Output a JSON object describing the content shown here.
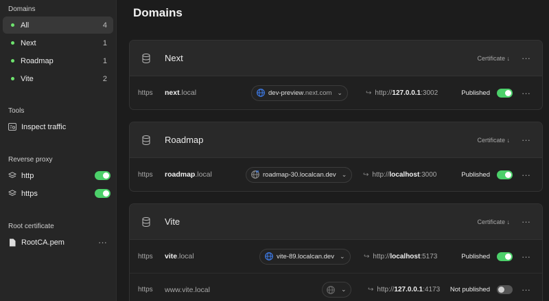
{
  "sidebar": {
    "domains_title": "Domains",
    "domains": [
      {
        "label": "All",
        "count": "4",
        "active": true
      },
      {
        "label": "Next",
        "count": "1"
      },
      {
        "label": "Roadmap",
        "count": "1"
      },
      {
        "label": "Vite",
        "count": "2"
      }
    ],
    "tools_title": "Tools",
    "tools": [
      {
        "label": "Inspect traffic",
        "icon": "inspect-traffic-icon"
      }
    ],
    "proxy_title": "Reverse proxy",
    "proxy": [
      {
        "label": "http",
        "icon": "layers-icon",
        "enabled": true
      },
      {
        "label": "https",
        "icon": "layers-icon",
        "enabled": true
      }
    ],
    "root_title": "Root certificate",
    "root": {
      "label": "RootCA.pem",
      "icon": "file-icon",
      "more": "···"
    }
  },
  "main": {
    "title": "Domains",
    "cards": [
      {
        "name": "Next",
        "cert_label": "Certificate ↓",
        "more": "···",
        "rows": [
          {
            "scheme": "https",
            "host_bold": "next",
            "host_rest": ".local",
            "tunnel_main": "dev-preview",
            "tunnel_rest": ".next.com",
            "target_prefix": "http://",
            "target_bold": "127.0.0.1",
            "target_port": ":3002",
            "status": "Published",
            "published": true,
            "more": "···"
          }
        ]
      },
      {
        "name": "Roadmap",
        "cert_label": "Certificate ↓",
        "more": "···",
        "rows": [
          {
            "scheme": "https",
            "host_bold": "roadmap",
            "host_rest": ".local",
            "tunnel_main": "roadmap-30",
            "tunnel_rest": ".localcan.dev",
            "target_prefix": "http://",
            "target_bold": "localhost",
            "target_port": ":3000",
            "status": "Published",
            "published": true,
            "more": "···"
          }
        ]
      },
      {
        "name": "Vite",
        "cert_label": "Certificate ↓",
        "more": "···",
        "rows": [
          {
            "scheme": "https",
            "host_bold": "vite",
            "host_rest": ".local",
            "tunnel_main": "vite-89",
            "tunnel_rest": ".localcan.dev",
            "target_prefix": "http://",
            "target_bold": "localhost",
            "target_port": ":5173",
            "status": "Published",
            "published": true,
            "more": "···"
          },
          {
            "scheme": "https",
            "host_bold": "www.vite",
            "host_rest": ".local",
            "tunnel_main": "",
            "tunnel_rest": "",
            "target_prefix": "http://",
            "target_bold": "127.0.0.1",
            "target_port": ":4173",
            "status": "Not published",
            "published": false,
            "more": "···"
          }
        ]
      }
    ]
  },
  "colors": {
    "accent_green": "#4cd06a",
    "dot_green": "#6ee36e",
    "globe_blue": "#3d7be8"
  }
}
